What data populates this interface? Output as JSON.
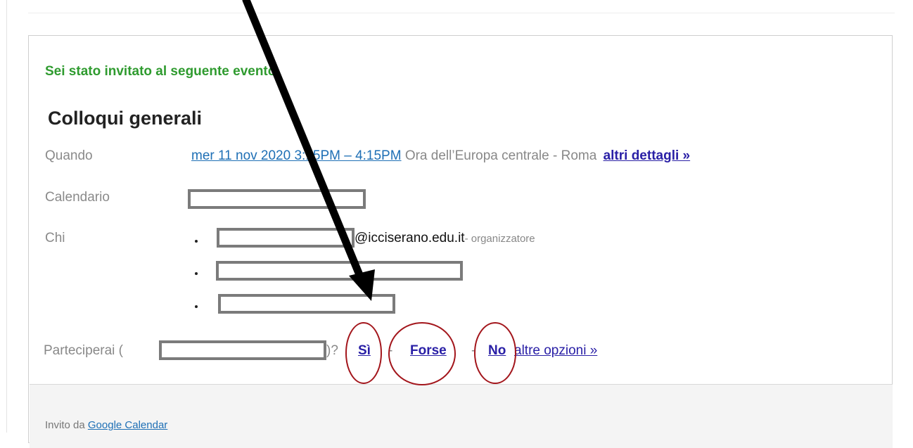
{
  "invite": {
    "intro": "Sei stato invitato al seguente evento.",
    "title": "Colloqui generali",
    "when": {
      "label": "Quando",
      "datetime": "mer 11 nov 2020 3:15PM – 4:15PM",
      "timezone": "Ora dell’Europa centrale - Roma",
      "more": "altri dettagli »"
    },
    "calendar": {
      "label": "Calendario"
    },
    "who": {
      "label": "Chi",
      "organizer_domain": "@icciserano.edu.it",
      "organizer_role": "- organizzatore"
    },
    "rsvp": {
      "label": "Parteciperai (",
      "close": ")?",
      "yes": "Sì",
      "maybe": "Forse",
      "no": "No",
      "sep": "-",
      "more": "altre opzioni »"
    },
    "footer": {
      "prefix": "Invito da ",
      "link": "Google Calendar"
    }
  },
  "colors": {
    "intro": "#2f9b2f",
    "link": "#1e6fb5",
    "action_link": "#2a20a6",
    "annotation_arrow": "#000000",
    "annotation_circle": "#a3161c"
  }
}
